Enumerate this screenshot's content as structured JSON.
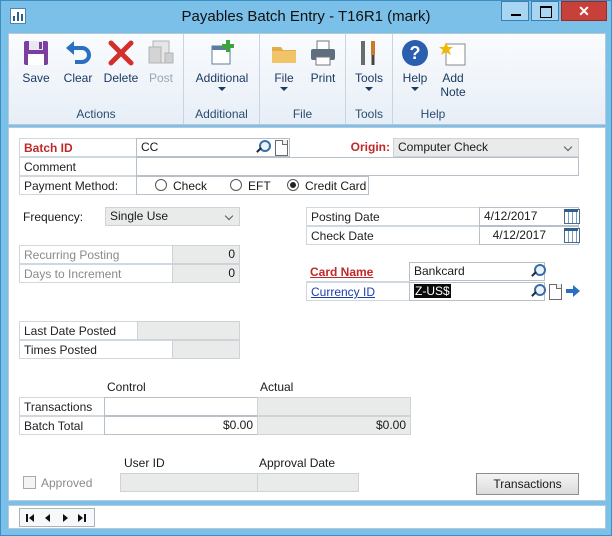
{
  "window": {
    "title": "Payables Batch Entry  -  T16R1 (mark)",
    "close_glyph": "✕"
  },
  "ribbon": {
    "groups": [
      {
        "label": "Actions",
        "buttons": [
          {
            "label": "Save",
            "icon": "floppy-disk-icon"
          },
          {
            "label": "Clear",
            "icon": "undo-arrow-icon"
          },
          {
            "label": "Delete",
            "icon": "red-x-icon"
          },
          {
            "label": "Post",
            "icon": "post-document-icon",
            "disabled": true
          }
        ]
      },
      {
        "label": "Additional",
        "buttons": [
          {
            "label": "Additional",
            "icon": "add-window-icon",
            "dropdown": true
          }
        ]
      },
      {
        "label": "File",
        "buttons": [
          {
            "label": "File",
            "icon": "folder-icon",
            "dropdown": true
          },
          {
            "label": "Print",
            "icon": "printer-icon"
          }
        ]
      },
      {
        "label": "Tools",
        "buttons": [
          {
            "label": "Tools",
            "icon": "tools-icon",
            "dropdown": true
          }
        ]
      },
      {
        "label": "Help",
        "buttons": [
          {
            "label": "Help",
            "icon": "help-icon",
            "dropdown": true
          },
          {
            "label": "Add",
            "label2": "Note",
            "icon": "add-note-icon"
          }
        ]
      }
    ]
  },
  "form": {
    "batch_id": {
      "label": "Batch ID",
      "value": "CC"
    },
    "origin": {
      "label": "Origin:",
      "value": "Computer Check"
    },
    "comment": {
      "label": "Comment",
      "value": ""
    },
    "payment_method": {
      "label": "Payment Method:",
      "options": [
        "Check",
        "EFT",
        "Credit Card"
      ],
      "selected": "Credit Card"
    },
    "frequency": {
      "label": "Frequency:",
      "value": "Single Use"
    },
    "recurring_posting": {
      "label": "Recurring Posting",
      "value": "0"
    },
    "days_to_increment": {
      "label": "Days to Increment",
      "value": "0"
    },
    "posting_date": {
      "label": "Posting Date",
      "value": "4/12/2017"
    },
    "check_date": {
      "label": "Check Date",
      "value": "4/12/2017"
    },
    "card_name": {
      "label": "Card Name",
      "value": "Bankcard"
    },
    "currency_id": {
      "label": "Currency ID",
      "value": "Z-US$"
    },
    "last_date_posted": {
      "label": "Last Date Posted",
      "value": ""
    },
    "times_posted": {
      "label": "Times Posted",
      "value": ""
    },
    "totals": {
      "control_header": "Control",
      "actual_header": "Actual",
      "transactions_label": "Transactions",
      "batch_total_label": "Batch Total",
      "control_transactions": "",
      "actual_transactions": "",
      "control_total": "$0.00",
      "actual_total": "$0.00"
    },
    "approved_label": "Approved",
    "user_id_label": "User ID",
    "approval_date_label": "Approval Date",
    "transactions_button": "Transactions"
  },
  "colors": {
    "required_label": "#c0282a",
    "link": "#1b3fa8",
    "window_frame": "#7ac0e8"
  }
}
